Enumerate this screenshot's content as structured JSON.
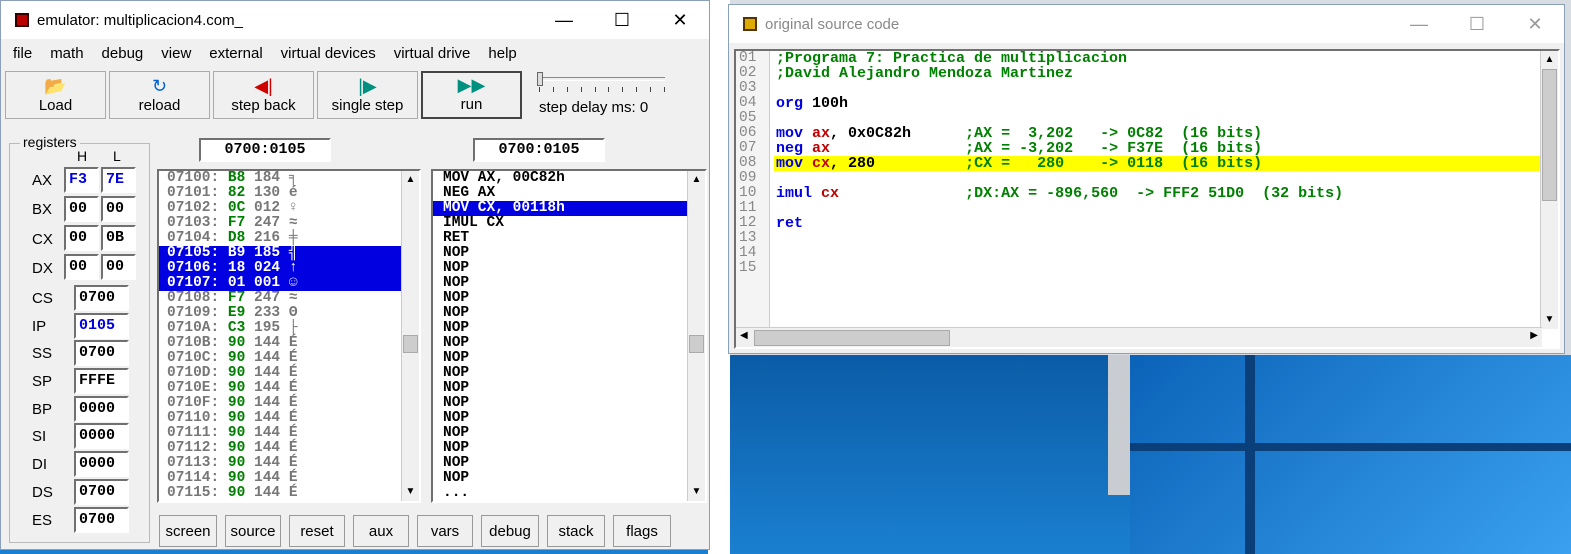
{
  "emu": {
    "title": "emulator: multiplicacion4.com_",
    "menu": [
      "file",
      "math",
      "debug",
      "view",
      "external",
      "virtual devices",
      "virtual drive",
      "help"
    ],
    "toolbar": [
      {
        "label": "Load",
        "icon": "folder-open-icon",
        "glyph": "📂"
      },
      {
        "label": "reload",
        "icon": "reload-icon",
        "glyph": "↻"
      },
      {
        "label": "step back",
        "icon": "step-back-icon",
        "glyph": "◀|"
      },
      {
        "label": "single step",
        "icon": "single-step-icon",
        "glyph": "|▶"
      },
      {
        "label": "run",
        "icon": "run-icon",
        "glyph": "▶▶"
      }
    ],
    "step_delay": "step delay ms: 0",
    "registers_label": "registers",
    "h": "H",
    "l": "L",
    "regs8": [
      {
        "name": "AX",
        "h": "F3",
        "l": "7E"
      },
      {
        "name": "BX",
        "h": "00",
        "l": "00"
      },
      {
        "name": "CX",
        "h": "00",
        "l": "0B"
      },
      {
        "name": "DX",
        "h": "00",
        "l": "00"
      }
    ],
    "regs16": [
      {
        "name": "CS",
        "val": "0700"
      },
      {
        "name": "IP",
        "val": "0105"
      },
      {
        "name": "SS",
        "val": "0700"
      },
      {
        "name": "SP",
        "val": "FFFE"
      },
      {
        "name": "BP",
        "val": "0000"
      },
      {
        "name": "SI",
        "val": "0000"
      },
      {
        "name": "DI",
        "val": "0000"
      },
      {
        "name": "DS",
        "val": "0700"
      },
      {
        "name": "ES",
        "val": "0700"
      }
    ],
    "addr_left": "0700:0105",
    "addr_right": "0700:0105",
    "memory": [
      {
        "a": "07100:",
        "h": "B8",
        "d": "184",
        "c": "╕"
      },
      {
        "a": "07101:",
        "h": "82",
        "d": "130",
        "c": "é"
      },
      {
        "a": "07102:",
        "h": "0C",
        "d": "012",
        "c": "♀"
      },
      {
        "a": "07103:",
        "h": "F7",
        "d": "247",
        "c": "≈"
      },
      {
        "a": "07104:",
        "h": "D8",
        "d": "216",
        "c": "╪"
      },
      {
        "a": "07105:",
        "h": "B9",
        "d": "185",
        "c": "╣"
      },
      {
        "a": "07106:",
        "h": "18",
        "d": "024",
        "c": "↑"
      },
      {
        "a": "07107:",
        "h": "01",
        "d": "001",
        "c": "☺"
      },
      {
        "a": "07108:",
        "h": "F7",
        "d": "247",
        "c": "≈"
      },
      {
        "a": "07109:",
        "h": "E9",
        "d": "233",
        "c": "Θ"
      },
      {
        "a": "0710A:",
        "h": "C3",
        "d": "195",
        "c": "├"
      },
      {
        "a": "0710B:",
        "h": "90",
        "d": "144",
        "c": "É"
      },
      {
        "a": "0710C:",
        "h": "90",
        "d": "144",
        "c": "É"
      },
      {
        "a": "0710D:",
        "h": "90",
        "d": "144",
        "c": "É"
      },
      {
        "a": "0710E:",
        "h": "90",
        "d": "144",
        "c": "É"
      },
      {
        "a": "0710F:",
        "h": "90",
        "d": "144",
        "c": "É"
      },
      {
        "a": "07110:",
        "h": "90",
        "d": "144",
        "c": "É"
      },
      {
        "a": "07111:",
        "h": "90",
        "d": "144",
        "c": "É"
      },
      {
        "a": "07112:",
        "h": "90",
        "d": "144",
        "c": "É"
      },
      {
        "a": "07113:",
        "h": "90",
        "d": "144",
        "c": "É"
      },
      {
        "a": "07114:",
        "h": "90",
        "d": "144",
        "c": "É"
      },
      {
        "a": "07115:",
        "h": "90",
        "d": "144",
        "c": "É"
      }
    ],
    "disasm": [
      "MOV AX, 00C82h",
      "NEG AX",
      "MOV CX, 00118h",
      "IMUL CX",
      "RET",
      "NOP",
      "NOP",
      "NOP",
      "NOP",
      "NOP",
      "NOP",
      "NOP",
      "NOP",
      "NOP",
      "NOP",
      "NOP",
      "NOP",
      "NOP",
      "NOP",
      "NOP",
      "NOP",
      "..."
    ],
    "bottom": [
      "screen",
      "source",
      "reset",
      "aux",
      "vars",
      "debug",
      "stack",
      "flags"
    ]
  },
  "src": {
    "title": "original source code",
    "lines": [
      "01",
      "02",
      "03",
      "04",
      "05",
      "06",
      "07",
      "08",
      "09",
      "10",
      "11",
      "12",
      "13",
      "14",
      "15"
    ],
    "code": [
      ";Programa 7: Practica de multiplicacion",
      ";David Alejandro Mendoza Martinez",
      "",
      "org 100h",
      "",
      "mov ax, 0x0C82h      ;AX =  3,202   -> 0C82  (16 bits)",
      "neg ax               ;AX = -3,202   -> F37E  (16 bits)",
      "mov cx, 280          ;CX =   280    -> 0118  (16 bits)",
      "",
      "imul cx              ;DX:AX = -896,560  -> FFF2 51D0  (32 bits)",
      "",
      "ret",
      "",
      "",
      ""
    ]
  },
  "colors": {
    "highlight": "#ffff00",
    "selection": "#0000e0",
    "keyword": "#0000e0",
    "register": "#c00000",
    "comment": "#008000"
  }
}
